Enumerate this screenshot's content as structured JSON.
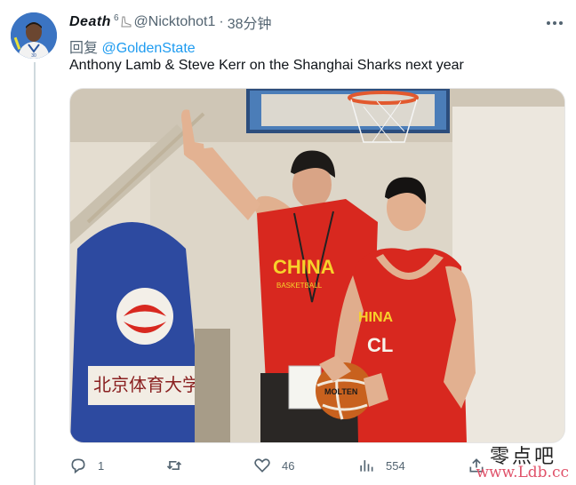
{
  "tweet": {
    "display_name": "Death",
    "badge": "6",
    "handle": "@Nicktohot1",
    "separator": "·",
    "time": "38分钟",
    "reply_prefix": "回复",
    "reply_mention": "@GoldenState",
    "text": "Anthony Lamb & Steve Kerr on the Shanghai Sharks next year"
  },
  "photo": {
    "jersey_left": "CHINA",
    "jersey_left_sub": "BASKETBALL",
    "jersey_right": "HINA",
    "jersey_right_sub": "CL",
    "ball_text": "MOLTEN",
    "banner_text": "北京体育大学"
  },
  "actions": {
    "reply_count": "1",
    "retweet_count": "",
    "like_count": "46",
    "views_count": "554"
  },
  "watermark": {
    "text": "零点吧",
    "url": "www.Ldb.cc"
  },
  "colors": {
    "accent": "#1d9bf0",
    "secondary_text": "#536471",
    "jersey_red": "#d8281f",
    "watermark_pink": "#e0526a"
  }
}
